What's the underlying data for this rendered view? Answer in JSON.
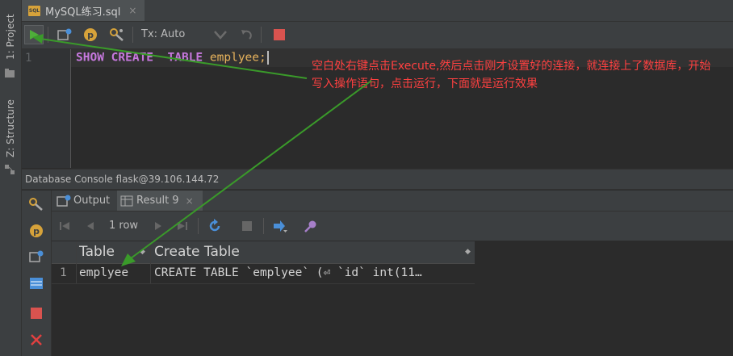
{
  "left_strip": {
    "project_tab": "1: Project",
    "structure_tab": "Z: Structure"
  },
  "tabbar": {
    "file_badge": "SQL",
    "file_name": "MySQL练习.sql",
    "close_glyph": "×"
  },
  "toolbar": {
    "tx_label": "Tx: Auto",
    "icons": [
      "run-icon",
      "console-icon",
      "p-icon",
      "wrench-icon",
      "commit-icon",
      "undo-icon",
      "stop-icon"
    ]
  },
  "editor": {
    "line_number": "1",
    "tokens": [
      "SHOW",
      "CREATE",
      "TABLE",
      "emplyee",
      ";"
    ]
  },
  "annotation": {
    "text": "空白处右键点击Execute,然后点击刚才设置好的连接，就连接上了数据库，开始写入操作语句，点击运行，下面就是运行效果"
  },
  "console": {
    "title": "Database Console flask@39.106.144.72"
  },
  "result_tabs": {
    "output_label": "Output",
    "result_label": "Result 9",
    "close_glyph": "×"
  },
  "result_toolbar": {
    "row_count": "1 row"
  },
  "grid": {
    "columns": [
      "Table",
      "Create Table"
    ],
    "rows": [
      {
        "num": "1",
        "table": "emplyee",
        "create": "CREATE TABLE `emplyee` (⏎  `id` int(11…"
      }
    ]
  },
  "colors": {
    "annotation": "#ff4040",
    "arrow": "#3a9a2a",
    "run": "#4fae3a",
    "keyword": "#c678dd",
    "identifier": "#e6b25c"
  }
}
